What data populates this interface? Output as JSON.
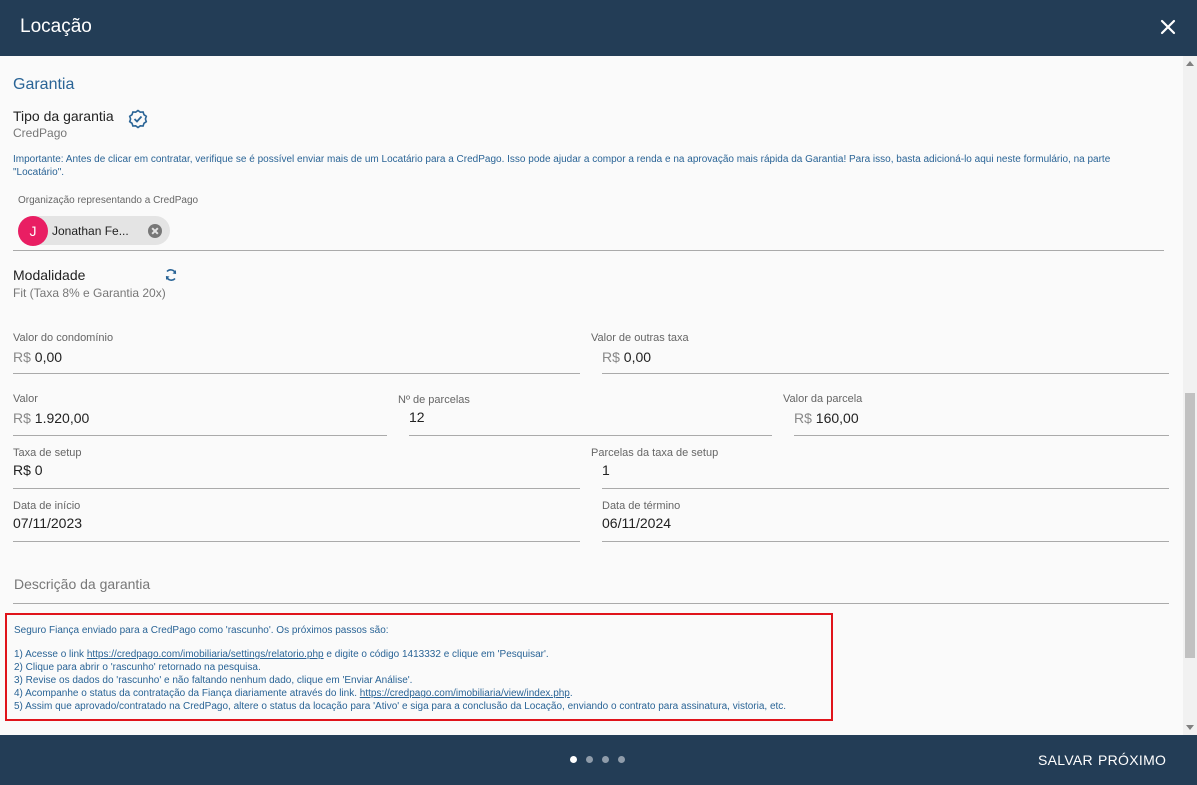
{
  "header": {
    "title": "Locação",
    "close_icon": "close-icon"
  },
  "garantia": {
    "section_title": "Garantia",
    "tipo_label": "Tipo da garantia",
    "tipo_value": "CredPago",
    "tipo_icon": "verified-badge-icon",
    "note": "Importante: Antes de clicar em contratar, verifique se é possível enviar mais de um Locatário para a CredPago. Isso pode ajudar a compor a renda e na aprovação mais rápida da Garantia! Para isso, basta adicioná-lo aqui neste formulário, na parte \"Locatário\".",
    "org_label": "Organização representando a CredPago",
    "org_chip": {
      "initial": "J",
      "name": "Jonathan Fe..."
    },
    "modalidade_label": "Modalidade",
    "modalidade_value": "Fit (Taxa 8% e Garantia 20x)",
    "modalidade_icon": "refresh-icon"
  },
  "fields": {
    "currency": "R$",
    "condominio": {
      "label": "Valor do condomínio",
      "value": "0,00"
    },
    "outras_taxas": {
      "label": "Valor de outras taxa",
      "value": "0,00"
    },
    "valor": {
      "label": "Valor",
      "value": "1.920,00"
    },
    "parcelas": {
      "label": "Nº de parcelas",
      "value": "12"
    },
    "valor_parcela": {
      "label": "Valor da parcela",
      "value": "160,00"
    },
    "taxa_setup": {
      "label": "Taxa de setup",
      "value": "R$ 0"
    },
    "parcelas_setup": {
      "label": "Parcelas da taxa de setup",
      "value": "1"
    },
    "data_inicio": {
      "label": "Data de início",
      "value": "07/11/2023"
    },
    "data_termino": {
      "label": "Data de término",
      "value": "06/11/2024"
    },
    "descricao_placeholder": "Descrição da garantia"
  },
  "steps": {
    "intro": "Seguro Fiança enviado para a CredPago como 'rascunho'. Os próximos passos são:",
    "s1_pre": "1) Acesse o link ",
    "s1_link": "https://credpago.com/imobiliaria/settings/relatorio.php",
    "s1_post": " e digite o código 1413332 e clique em 'Pesquisar'.",
    "s2": "2) Clique para abrir o 'rascunho' retornado na pesquisa.",
    "s3": "3) Revise os dados do 'rascunho' e não faltando nenhum dado, clique em 'Enviar Análise'.",
    "s4_pre": "4) Acompanhe o status da contratação da Fiança diariamente através do link. ",
    "s4_link": "https://credpago.com/imobiliaria/view/index.php",
    "s4_post": ".",
    "s5": "5) Assim que aprovado/contratado na CredPago, altere o status da locação para 'Ativo' e siga para a conclusão da Locação, enviando o contrato para assinatura, vistoria, etc."
  },
  "footer": {
    "pagination": {
      "total": 4,
      "current": 1
    },
    "save_label": "SALVAR",
    "next_label": "PRÓXIMO"
  }
}
